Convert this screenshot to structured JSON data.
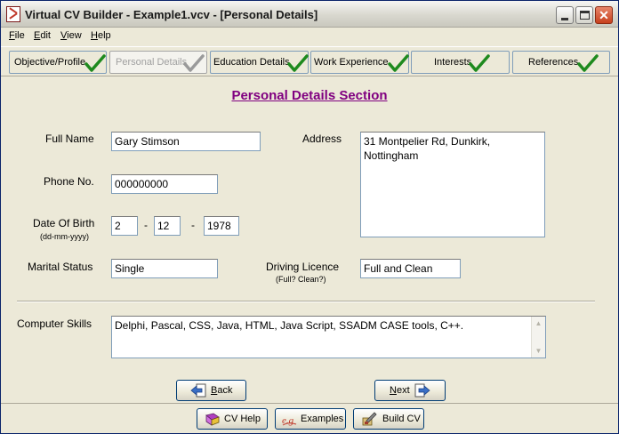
{
  "window": {
    "title": "Virtual CV Builder - Example1.vcv - [Personal Details]"
  },
  "menu": [
    {
      "label": "File",
      "accel": "F",
      "rest": "ile"
    },
    {
      "label": "Edit",
      "accel": "E",
      "rest": "dit"
    },
    {
      "label": "View",
      "accel": "V",
      "rest": "iew"
    },
    {
      "label": "Help",
      "accel": "H",
      "rest": "elp"
    }
  ],
  "tabs": [
    {
      "label": "Objective/Profile",
      "state": "complete",
      "enabled": true
    },
    {
      "label": "Personal Details",
      "state": "current",
      "enabled": false
    },
    {
      "label": "Education Details",
      "state": "complete",
      "enabled": true
    },
    {
      "label": "Work Experience",
      "state": "complete",
      "enabled": true
    },
    {
      "label": "Interests",
      "state": "complete",
      "enabled": true
    },
    {
      "label": "References",
      "state": "complete",
      "enabled": true
    }
  ],
  "section": {
    "heading": "Personal Details Section"
  },
  "form": {
    "full_name": {
      "label": "Full Name",
      "value": "Gary Stimson"
    },
    "phone": {
      "label": "Phone No.",
      "value": "000000000"
    },
    "dob": {
      "label": "Date Of Birth",
      "hint": "(dd-mm-yyyy)",
      "day": "2",
      "month": "12",
      "year": "1978",
      "separator": "-"
    },
    "marital": {
      "label": "Marital Status",
      "value": "Single"
    },
    "address": {
      "label": "Address",
      "value": "31 Montpelier Rd, Dunkirk, Nottingham"
    },
    "driving": {
      "label": "Driving Licence",
      "hint": "(Full? Clean?)",
      "value": "Full and Clean"
    },
    "skills": {
      "label": "Computer Skills",
      "value": "Delphi, Pascal, CSS, Java, HTML, Java Script, SSADM CASE tools, C++."
    }
  },
  "nav": {
    "back": "Back",
    "back_accel": "B",
    "back_rest": "ack",
    "next": "Next",
    "next_accel": "N",
    "next_rest": "ext"
  },
  "footer": {
    "cv_help": "CV Help",
    "examples": "Examples",
    "build_cv": "Build CV"
  },
  "colors": {
    "heading": "#800080",
    "check": "#1e8a1e",
    "check_disabled": "#9a9a9a"
  }
}
